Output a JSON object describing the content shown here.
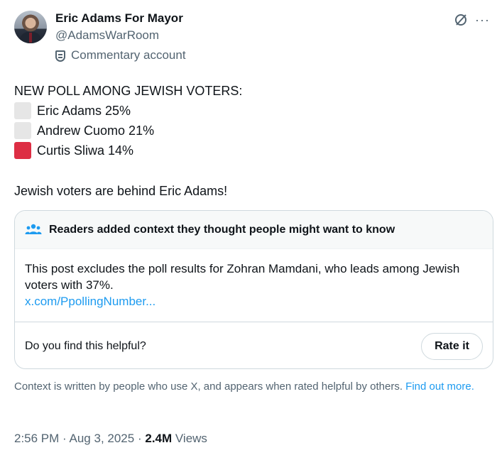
{
  "author": {
    "name": "Eric Adams For Mayor",
    "handle": "@AdamsWarRoom",
    "label": "Commentary account"
  },
  "icons": {
    "header_right": [
      "no-sign-icon",
      "more-icon"
    ],
    "more_glyph": "···"
  },
  "tweet": {
    "heading": "NEW POLL AMONG JEWISH VOTERS:",
    "poll": [
      {
        "text": "Eric Adams 25%",
        "color": "#e6e6e6"
      },
      {
        "text": "Andrew Cuomo 21%",
        "color": "#e6e6e6"
      },
      {
        "text": "Curtis Sliwa 14%",
        "color": "#dd2e44"
      }
    ],
    "tagline": "Jewish voters are behind Eric Adams!"
  },
  "community_note": {
    "title": "Readers added context they thought people might want to know",
    "body": "This post excludes the poll results for Zohran Mamdani, who leads among Jewish voters with 37%.",
    "link": "x.com/PpollingNumber...",
    "question": "Do you find this helpful?",
    "rate_label": "Rate it"
  },
  "disclaimer": {
    "text": "Context is written by people who use X, and appears when rated helpful by others.",
    "link": "Find out more."
  },
  "meta": {
    "time": "2:56 PM",
    "date": "Aug 3, 2025",
    "separator": "·",
    "views_count": "2.4M",
    "views_label": "Views"
  },
  "colors": {
    "accent": "#1d9bf0",
    "secondary_text": "#536471",
    "border": "#cfd9de"
  }
}
